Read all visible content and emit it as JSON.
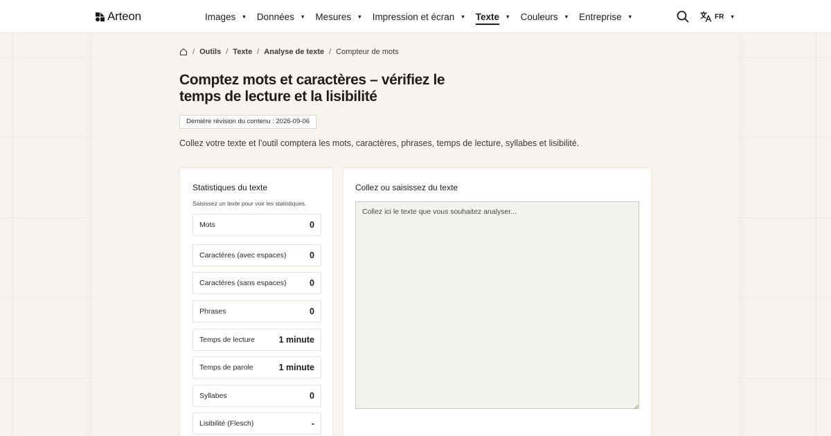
{
  "brand": {
    "name": "Arteon"
  },
  "nav": {
    "items": [
      {
        "label": "Images",
        "active": false
      },
      {
        "label": "Données",
        "active": false
      },
      {
        "label": "Mesures",
        "active": false
      },
      {
        "label": "Impression et écran",
        "active": false
      },
      {
        "label": "Texte",
        "active": true
      },
      {
        "label": "Couleurs",
        "active": false
      },
      {
        "label": "Entreprise",
        "active": false
      }
    ],
    "caret": "▾"
  },
  "language": {
    "code": "FR",
    "icon": "translate-icon"
  },
  "breadcrumb": {
    "home_icon": "home-icon",
    "separator": "/",
    "items": [
      "Outils",
      "Texte",
      "Analyse de texte"
    ],
    "current": "Compteur de mots"
  },
  "page": {
    "title": "Comptez mots et caractères – vérifiez le temps de lecture et la lisibilité",
    "revision": "Dernière révision du contenu : 2026-09-06",
    "intro": "Collez votre texte et l’outil comptera les mots, caractères, phrases, temps de lecture, syllabes et lisibilité."
  },
  "stats": {
    "title": "Statistiques du texte",
    "hint": "Saisissez un texte pour voir les statistiques.",
    "rows": [
      {
        "label": "Mots",
        "value": "0"
      },
      {
        "label": "Caractères (avec espaces)",
        "value": "0"
      },
      {
        "label": "Caractères (sans espaces)",
        "value": "0"
      },
      {
        "label": "Phrases",
        "value": "0"
      },
      {
        "label": "Temps de lecture",
        "value": "1 minute"
      },
      {
        "label": "Temps de parole",
        "value": "1 minute"
      },
      {
        "label": "Syllabes",
        "value": "0"
      },
      {
        "label": "Lisibilité (Flesch)",
        "value": "-"
      }
    ]
  },
  "editor": {
    "title": "Collez ou saisissez du texte",
    "value": "",
    "placeholder": "Collez ici le texte que vous souhaitez analyser..."
  },
  "colors": {
    "background": "#f6f2ee",
    "text": "#1f1d1a",
    "card": "#ffffff",
    "textarea": "#f4f2ef"
  }
}
